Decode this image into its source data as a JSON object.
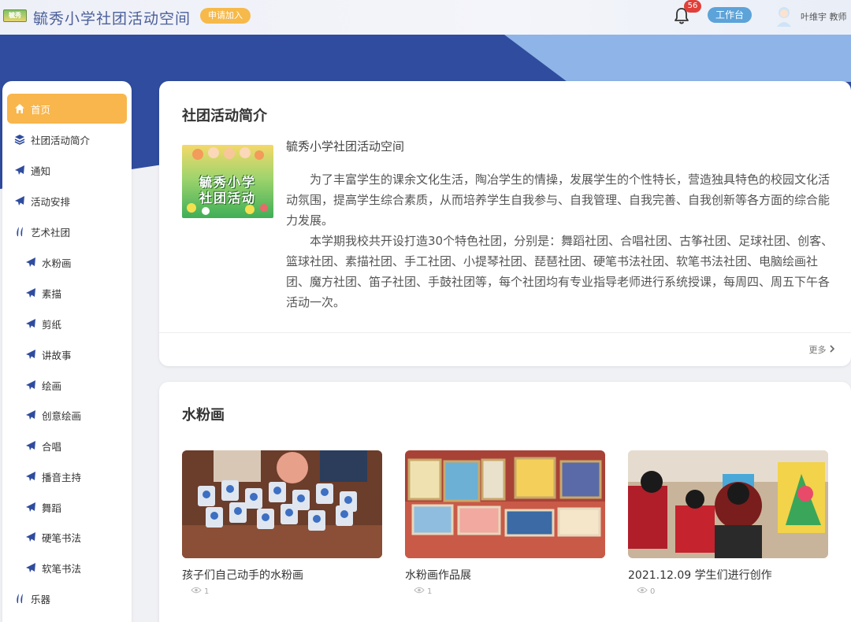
{
  "header": {
    "logo_text": "毓秀",
    "title": "毓秀小学社团活动空间",
    "apply_label": "申请加入",
    "notification_count": "56",
    "workbench_label": "工作台",
    "user_name": "叶维宇 教师"
  },
  "sidebar": {
    "items": [
      {
        "label": "首页",
        "icon": "home-icon",
        "active": true
      },
      {
        "label": "社团活动简介",
        "icon": "layers-icon"
      },
      {
        "label": "通知",
        "icon": "paper-plane-icon"
      },
      {
        "label": "活动安排",
        "icon": "paper-plane-icon"
      },
      {
        "label": "艺术社团",
        "icon": "feather-icon"
      },
      {
        "label": "水粉画",
        "icon": "paper-plane-icon"
      },
      {
        "label": "素描",
        "icon": "paper-plane-icon"
      },
      {
        "label": "剪纸",
        "icon": "paper-plane-icon"
      },
      {
        "label": "讲故事",
        "icon": "paper-plane-icon"
      },
      {
        "label": "绘画",
        "icon": "paper-plane-icon"
      },
      {
        "label": "创意绘画",
        "icon": "paper-plane-icon"
      },
      {
        "label": "合唱",
        "icon": "paper-plane-icon"
      },
      {
        "label": "播音主持",
        "icon": "paper-plane-icon"
      },
      {
        "label": "舞蹈",
        "icon": "paper-plane-icon"
      },
      {
        "label": "硬笔书法",
        "icon": "paper-plane-icon"
      },
      {
        "label": "软笔书法",
        "icon": "paper-plane-icon"
      },
      {
        "label": "乐器",
        "icon": "feather-icon"
      }
    ]
  },
  "intro": {
    "title": "社团活动简介",
    "image_text_line1": "毓秀小学",
    "image_text_line2": "社团活动",
    "subtitle": "毓秀小学社团活动空间",
    "paragraph1": "为了丰富学生的课余文化生活，陶冶学生的情操，发展学生的个性特长，营造独具特色的校园文化活动氛围，提高学生综合素质，从而培养学生自我参与、自我管理、自我完善、自我创新等各方面的综合能力发展。",
    "paragraph2": "本学期我校共开设打造30个特色社团，分别是：舞蹈社团、合唱社团、古筝社团、足球社团、创客、篮球社团、素描社团、手工社团、小提琴社团、琵琶社团、硬笔书法社团、软笔书法社团、电脑绘画社团、魔方社团、笛子社团、手鼓社团等，每个社团均有专业指导老师进行系统授课，每周四、周五下午各活动一次。",
    "more_label": "更多"
  },
  "gallery": {
    "title": "水粉画",
    "items": [
      {
        "title": "孩子们自己动手的水粉画",
        "views": "1"
      },
      {
        "title": "水粉画作品展",
        "views": "1"
      },
      {
        "title": "2021.12.09 学生们进行创作",
        "views": "0"
      }
    ]
  },
  "colors": {
    "accent": "#f8b64c",
    "brand_blue": "#2f4c9e",
    "light_blue": "#8fb4e8",
    "badge_red": "#e0403a"
  }
}
